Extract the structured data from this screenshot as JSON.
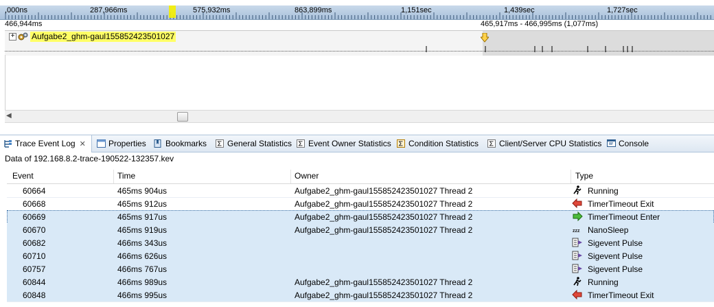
{
  "timeline": {
    "ruler_labels": [
      ",000ns",
      "287,966ms",
      "575,932ms",
      "863,899ms",
      "1,151sec",
      "1,439sec",
      "1,727sec"
    ],
    "position": "466,944ms",
    "range": "465,917ms - 466,995ms (1,077ms)",
    "track_label": "Aufgabe2_ghm-gaul155852423501027"
  },
  "tabs": [
    {
      "label": "Trace Event Log",
      "icon": "trace-log-icon"
    },
    {
      "label": "Properties",
      "icon": "properties-icon"
    },
    {
      "label": "Bookmarks",
      "icon": "bookmarks-icon"
    },
    {
      "label": "General Statistics",
      "icon": "sigma-icon"
    },
    {
      "label": "Event Owner Statistics",
      "icon": "sigma-icon"
    },
    {
      "label": "Condition Statistics",
      "icon": "sigma-icon"
    },
    {
      "label": "Client/Server CPU Statistics",
      "icon": "sigma-icon"
    },
    {
      "label": "Console",
      "icon": "console-icon"
    }
  ],
  "data_source": "Data of 192.168.8.2-trace-190522-132357.kev",
  "table": {
    "columns": [
      "Event",
      "Time",
      "Owner",
      "Type"
    ],
    "rows": [
      {
        "event": "60664",
        "time": "465ms 904us",
        "owner": "Aufgabe2_ghm-gaul155852423501027 Thread 2",
        "type": "Running",
        "icon": "running-icon",
        "selected": false
      },
      {
        "event": "60668",
        "time": "465ms 912us",
        "owner": "Aufgabe2_ghm-gaul155852423501027 Thread 2",
        "type": "TimerTimeout Exit",
        "icon": "arrow-left-icon",
        "selected": false
      },
      {
        "event": "60669",
        "time": "465ms 917us",
        "owner": "Aufgabe2_ghm-gaul155852423501027 Thread 2",
        "type": "TimerTimeout Enter",
        "icon": "arrow-right-icon",
        "selected": true
      },
      {
        "event": "60670",
        "time": "465ms 919us",
        "owner": "Aufgabe2_ghm-gaul155852423501027 Thread 2",
        "type": "NanoSleep",
        "icon": "sleep-icon",
        "selected": true
      },
      {
        "event": "60682",
        "time": "466ms 343us",
        "owner": "",
        "type": "Sigevent Pulse",
        "icon": "pulse-icon",
        "selected": true
      },
      {
        "event": "60710",
        "time": "466ms 626us",
        "owner": "",
        "type": "Sigevent Pulse",
        "icon": "pulse-icon",
        "selected": true
      },
      {
        "event": "60757",
        "time": "466ms 767us",
        "owner": "",
        "type": "Sigevent Pulse",
        "icon": "pulse-icon",
        "selected": true
      },
      {
        "event": "60844",
        "time": "466ms 989us",
        "owner": "Aufgabe2_ghm-gaul155852423501027 Thread 2",
        "type": "Running",
        "icon": "running-icon",
        "selected": true
      },
      {
        "event": "60848",
        "time": "466ms 995us",
        "owner": "Aufgabe2_ghm-gaul155852423501027 Thread 2",
        "type": "TimerTimeout Exit",
        "icon": "arrow-left-icon",
        "selected": true
      }
    ]
  }
}
